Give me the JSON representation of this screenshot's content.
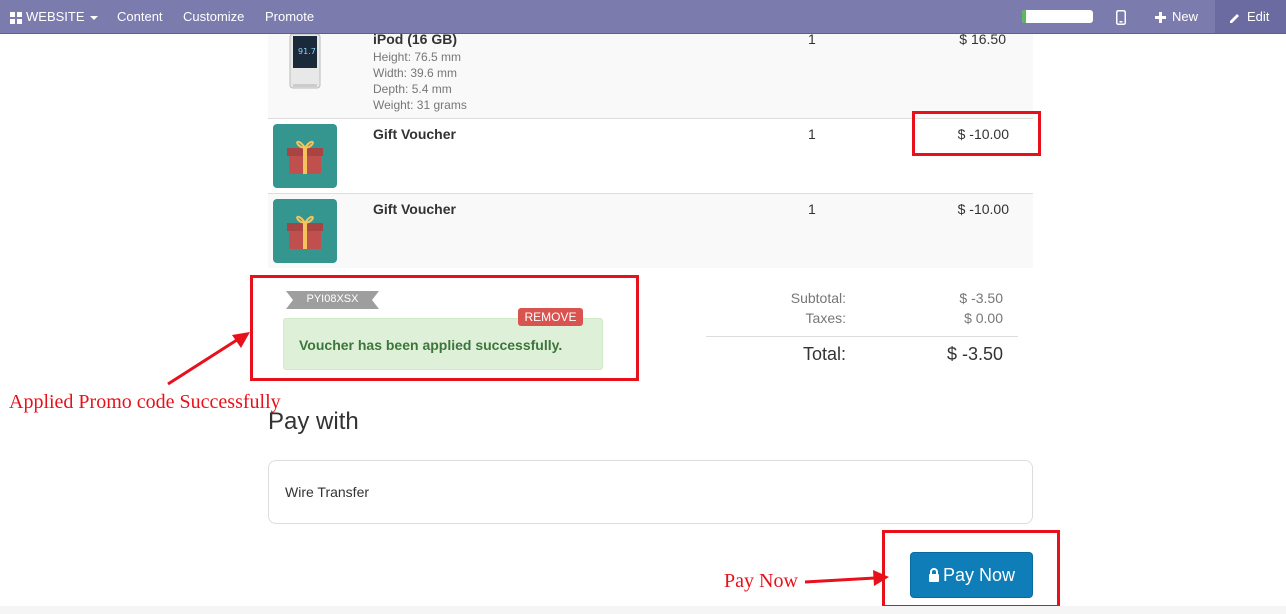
{
  "topbar": {
    "website_label": "WEBSITE",
    "menu": [
      "Content",
      "Customize",
      "Promote"
    ],
    "new_label": "New",
    "edit_label": "Edit",
    "progress_fraction": 0.05,
    "colors": {
      "bar": "#7c7bad",
      "progress": "#5cb85c"
    }
  },
  "cart": {
    "items": [
      {
        "name": "iPod (16 GB)",
        "details": [
          "Height: 76.5 mm",
          "Width: 39.6 mm",
          "Depth: 5.4 mm",
          "Weight: 31 grams"
        ],
        "quantity": "1",
        "price": "$ 16.50",
        "icon": "ipod-image"
      },
      {
        "name": "Gift Voucher",
        "quantity": "1",
        "price": "$ -10.00",
        "icon": "gift-icon"
      },
      {
        "name": "Gift Voucher",
        "quantity": "1",
        "price": "$ -10.00",
        "icon": "gift-icon"
      }
    ]
  },
  "promo": {
    "code": "PYI08XSX",
    "remove_label": "REMOVE",
    "message": "Voucher has been applied successfully."
  },
  "summary": {
    "subtotal_label": "Subtotal:",
    "subtotal_value": "$ -3.50",
    "taxes_label": "Taxes:",
    "taxes_value": "$ 0.00",
    "total_label": "Total:",
    "total_value": "$ -3.50"
  },
  "payment": {
    "heading": "Pay with",
    "option": "Wire Transfer",
    "pay_button": "Pay Now"
  },
  "annotations": {
    "promo_note": "Applied Promo code Successfully",
    "pay_note": "Pay Now",
    "color": "#e8101a"
  }
}
